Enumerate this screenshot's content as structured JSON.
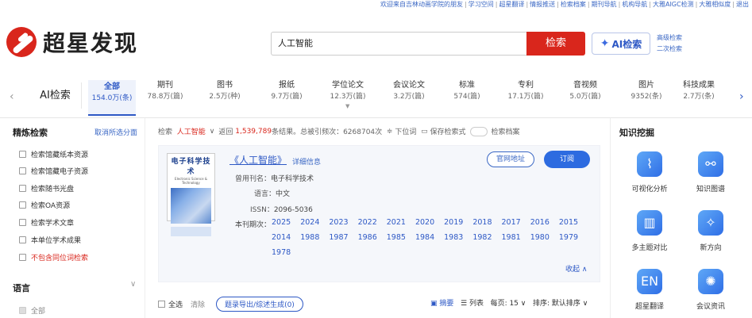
{
  "toplinks": [
    "欢迎来自吉林动画学院的朋友",
    "学习空间",
    "超星翻译",
    "情报推送",
    "检索档案",
    "期刊导航",
    "机构导航",
    "大雅AIGC检测",
    "大雅相似度",
    "退出"
  ],
  "brand": {
    "name": "超星发现"
  },
  "search": {
    "query": "人工智能",
    "button": "检索",
    "ai_button": "AI检索",
    "advanced": "高级检索",
    "secondary": "二次检索"
  },
  "categories": {
    "ai_label": "AI检索",
    "items": [
      {
        "name": "全部",
        "count": "154.0万(条)"
      },
      {
        "name": "期刊",
        "count": "78.8万(篇)"
      },
      {
        "name": "图书",
        "count": "2.5万(种)"
      },
      {
        "name": "报纸",
        "count": "9.7万(篇)"
      },
      {
        "name": "学位论文",
        "count": "12.3万(篇)"
      },
      {
        "name": "会议论文",
        "count": "3.2万(篇)"
      },
      {
        "name": "标准",
        "count": "574(篇)"
      },
      {
        "name": "专利",
        "count": "17.1万(篇)"
      },
      {
        "name": "音视频",
        "count": "5.0万(篇)"
      },
      {
        "name": "图片",
        "count": "9352(条)"
      },
      {
        "name": "科技成果",
        "count": "2.7万(条)"
      }
    ]
  },
  "refine": {
    "title": "精炼检索",
    "clear": "取消所选分面",
    "options": [
      "检索馆藏纸本资源",
      "检索馆藏电子资源",
      "检索随书光盘",
      "检索OA资源",
      "检索学术文章",
      "本单位学术成果",
      "不包含同位词检索"
    ],
    "lang_title": "语言",
    "lang_all": "全部"
  },
  "status": {
    "label": "检索",
    "term": "人工智能",
    "back": "返回",
    "count": "1,539,789",
    "count_suffix": "条结果。总被引频次：6268704次",
    "down": "下位词",
    "save": "保存检索式",
    "archive": "检索档案"
  },
  "journal": {
    "cover_title": "电子科学技术",
    "cover_sub": "Electronic Science & Technology",
    "title": "《人工智能》",
    "detail": "详细信息",
    "web_button": "官网地址",
    "subscribe_button": "订阅",
    "former_label": "曾用刊名：",
    "former": "电子科学技术",
    "lang_label": "语言：",
    "lang": "中文",
    "issn_label": "ISSN：",
    "issn": "2096-5036",
    "years_label": "本刊期次：",
    "years_row1": [
      "2025",
      "2024",
      "2023",
      "2022",
      "2021",
      "2020",
      "2019",
      "2018",
      "2017",
      "2016",
      "2015"
    ],
    "years_row2": [
      "2014",
      "1988",
      "1987",
      "1986",
      "1985",
      "1984",
      "1983",
      "1982",
      "1981",
      "1980",
      "1979"
    ],
    "years_row3": [
      "1978"
    ],
    "collapse": "收起 ∧"
  },
  "bottom": {
    "select_all": "全选",
    "clear": "清除",
    "export": "题录导出/综述生成(0)",
    "summary": "摘要",
    "list": "列表",
    "per_page": "每页: 15",
    "sort": "排序: 默认排序"
  },
  "knowledge": {
    "title": "知识挖掘",
    "tools": [
      "可视化分析",
      "知识图谱",
      "多主题对比",
      "新方向",
      "超星翻译",
      "会议资讯"
    ]
  },
  "colors": {
    "brand_red": "#d9261c",
    "link_blue": "#2d58c5",
    "card_bg": "#f5f7fb"
  }
}
